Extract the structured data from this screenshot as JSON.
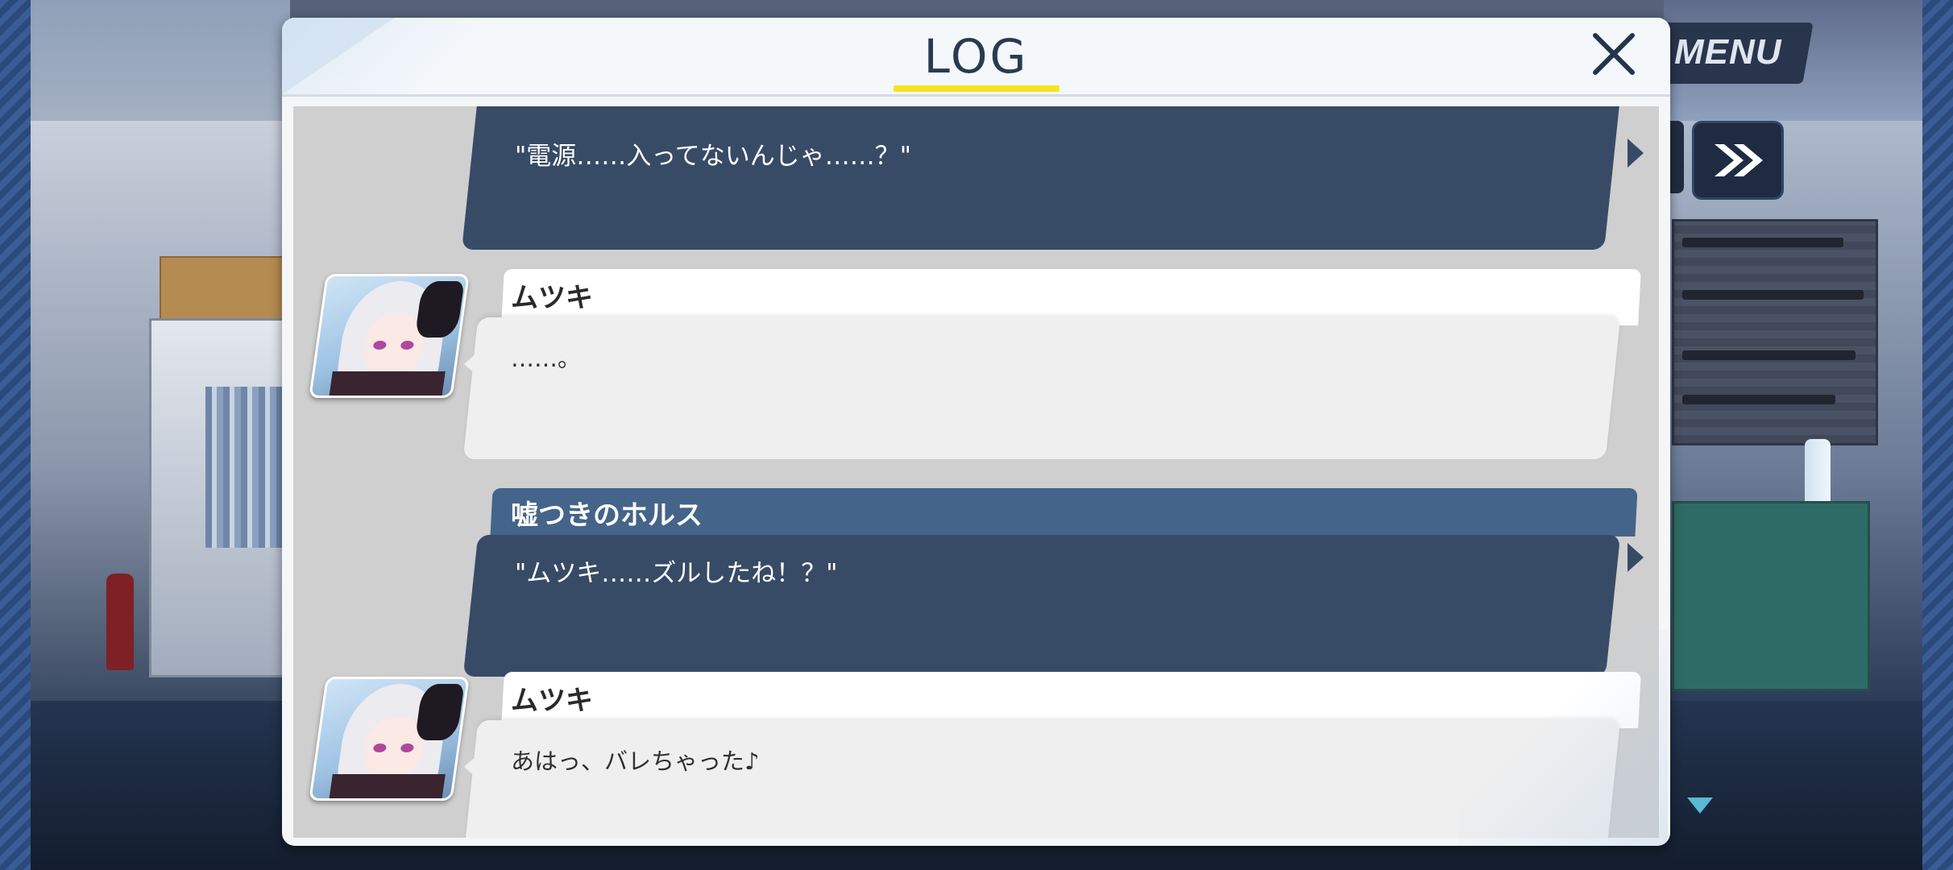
{
  "hud": {
    "menu_label": "MENU",
    "skip_icon": "double-chevron-right-icon",
    "next_indicator_icon": "triangle-down-icon",
    "accent_color": "#59b9d5"
  },
  "log_panel": {
    "title": "LOG",
    "close_icon": "close-x-icon",
    "title_underline_color": "#f7e323",
    "entries": [
      {
        "type": "player",
        "speaker": "",
        "text": "\"電源……入ってないんじゃ……？\""
      },
      {
        "type": "character",
        "speaker": "ムツキ",
        "avatar": "mutsuki-portrait",
        "text": "……。"
      },
      {
        "type": "player",
        "speaker": "嘘つきのホルス",
        "text": "\"ムツキ……ズルしたね！？\""
      },
      {
        "type": "character",
        "speaker": "ムツキ",
        "avatar": "mutsuki-portrait",
        "text": "あはっ、バレちゃった♪"
      }
    ]
  },
  "colors": {
    "player_bubble": "#384b66",
    "player_name_plate": "#44648a",
    "character_bubble": "#efefef",
    "panel_background": "#f4f6f8"
  }
}
